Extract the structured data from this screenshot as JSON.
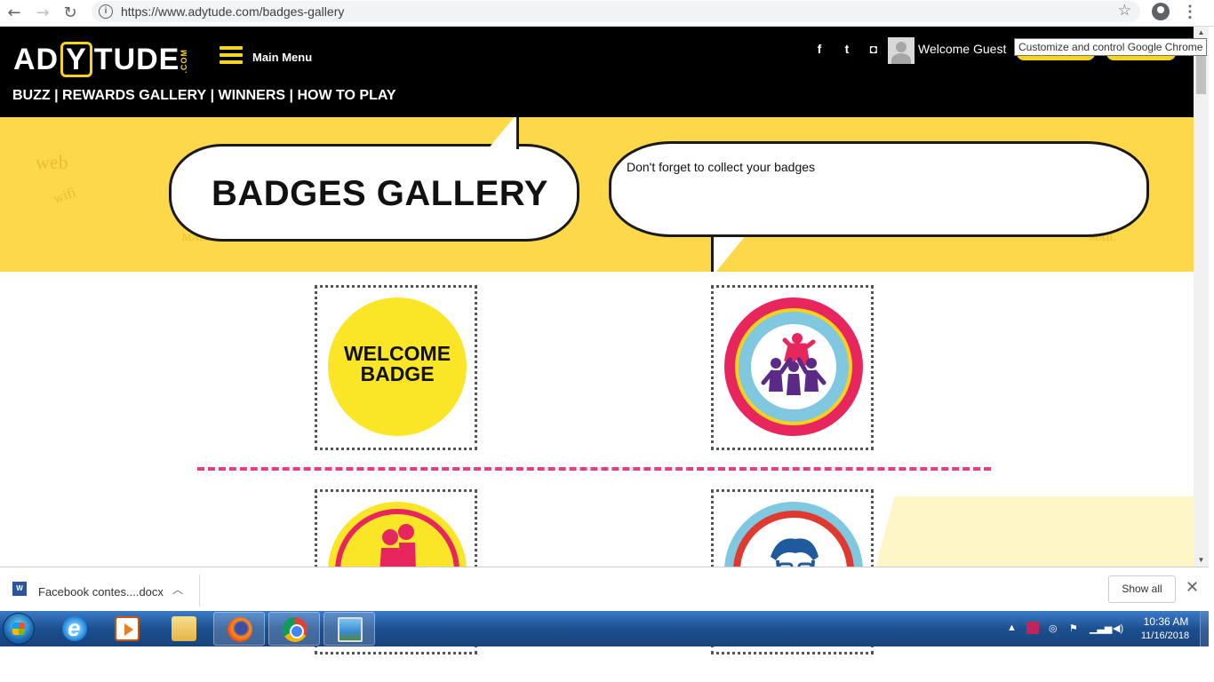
{
  "browser": {
    "url": "https://www.adytude.com/badges-gallery",
    "tooltip": "Customize and control Google Chrome"
  },
  "site": {
    "logo_left": "AD",
    "logo_y": "Y",
    "logo_right": "TUDE",
    "logo_com": ".COM",
    "main_menu": "Main Menu",
    "welcome": "Welcome Guest",
    "nav": [
      "BUZZ",
      "|",
      "REWARDS GALLERY",
      "|",
      "WINNERS",
      "|",
      "HOW TO PLAY"
    ],
    "social_facebook": "f",
    "social_twitter": "t",
    "social_instagram": "◘"
  },
  "banner": {
    "title": "BADGES GALLERY",
    "message": "Don't forget to collect your badges",
    "doodle_web": "web",
    "doodle_wifi": "wifi",
    "doodle_mail": "MAIL"
  },
  "badges": {
    "welcome_line1": "WELCOME",
    "welcome_line2": "BADGE"
  },
  "downloads": {
    "file_name": "Facebook contes....docx",
    "file_icon": "W",
    "show_all": "Show all"
  },
  "taskbar": {
    "time": "10:36 AM",
    "date": "11/16/2018"
  },
  "colors": {
    "brand_yellow": "#f6d31f",
    "banner_yellow": "#fdd84a",
    "accent_pink": "#e43f86"
  }
}
